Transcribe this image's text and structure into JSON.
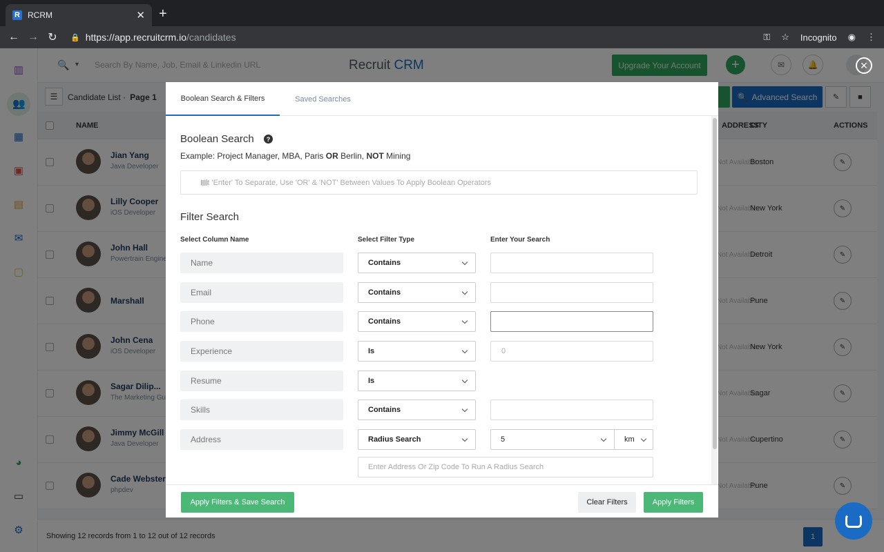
{
  "browser": {
    "tab_title": "RCRM",
    "favicon_letter": "R",
    "url_host": "https://app.recruitcrm.io",
    "url_path": "/candidates",
    "incognito_label": "Incognito"
  },
  "topnav": {
    "search_placeholder": "Search By Name, Job, Email & Linkedin URL",
    "logo_part1": "Recruit ",
    "logo_part2": "CRM",
    "upgrade_label": "Upgrade Your Account"
  },
  "toolbar": {
    "list_label": "Candidate List",
    "page_label": "Page 1",
    "advanced_search_label": "Advanced Search"
  },
  "table": {
    "headers": {
      "name": "NAME",
      "address": "ADDRESS",
      "city": "CITY",
      "actions": "ACTIONS"
    },
    "rows": [
      {
        "name": "Jian Yang",
        "title": "Java Developer",
        "address": "Not Available",
        "city": "Boston"
      },
      {
        "name": "Lilly Cooper",
        "title": "iOS Developer",
        "address": "Not Available",
        "city": "New York"
      },
      {
        "name": "John Hall",
        "title": "Powertrain Engine",
        "address": "Not Available",
        "city": "Detroit"
      },
      {
        "name": "Marshall",
        "title": "",
        "address": "Not Available",
        "city": "Pune"
      },
      {
        "name": "John Cena",
        "title": "iOS Developer",
        "address": "Not Available",
        "city": "New York"
      },
      {
        "name": "Sagar Dilip...",
        "title": "The Marketing Gu",
        "address": "Not Available",
        "city": "Sagar"
      },
      {
        "name": "Jimmy McGill",
        "title": "Java Developer",
        "address": "Not Available",
        "city": "Cupertino"
      },
      {
        "name": "Cade Webster",
        "title": "phpdev",
        "address": "Not Available",
        "city": "Pune"
      }
    ]
  },
  "footer": {
    "records_text": "Showing 12 records from 1 to 12 out of 12 records",
    "page_number": "1"
  },
  "modal": {
    "tabs": [
      "Boolean Search & Filters",
      "Saved Searches"
    ],
    "boolean_title": "Boolean Search",
    "help_glyph": "?",
    "example": {
      "prefix": "Example: Project Manager, MBA, Paris ",
      "or": "OR",
      "mid": " Berlin, ",
      "not": "NOT",
      "suffix": " Mining"
    },
    "boolean_placeholder": "Hit 'Enter' To Separate,  Use 'OR' & 'NOT' Between Values To Apply Boolean Operators",
    "filter_title": "Filter Search",
    "col_headers": [
      "Select Column Name",
      "Select Filter Type",
      "Enter Your Search"
    ],
    "filters": [
      {
        "column": "Name",
        "type": "Contains",
        "value": ""
      },
      {
        "column": "Email",
        "type": "Contains",
        "value": ""
      },
      {
        "column": "Phone",
        "type": "Contains",
        "value": ""
      },
      {
        "column": "Experience",
        "type": "Is",
        "value": "0"
      },
      {
        "column": "Resume",
        "type": "Is"
      },
      {
        "column": "Skills",
        "type": "Contains",
        "value": ""
      },
      {
        "column": "Address",
        "type": "Radius Search",
        "radius": "5",
        "unit": "km"
      }
    ],
    "address_placeholder": "Enter Address Or Zip Code To Run A Radius Search",
    "buttons": {
      "save": "Apply Filters & Save Search",
      "clear": "Clear Filters",
      "apply": "Apply Filters"
    }
  },
  "colors": {
    "accent_blue": "#1a6bc4",
    "accent_green": "#2fa65e"
  }
}
